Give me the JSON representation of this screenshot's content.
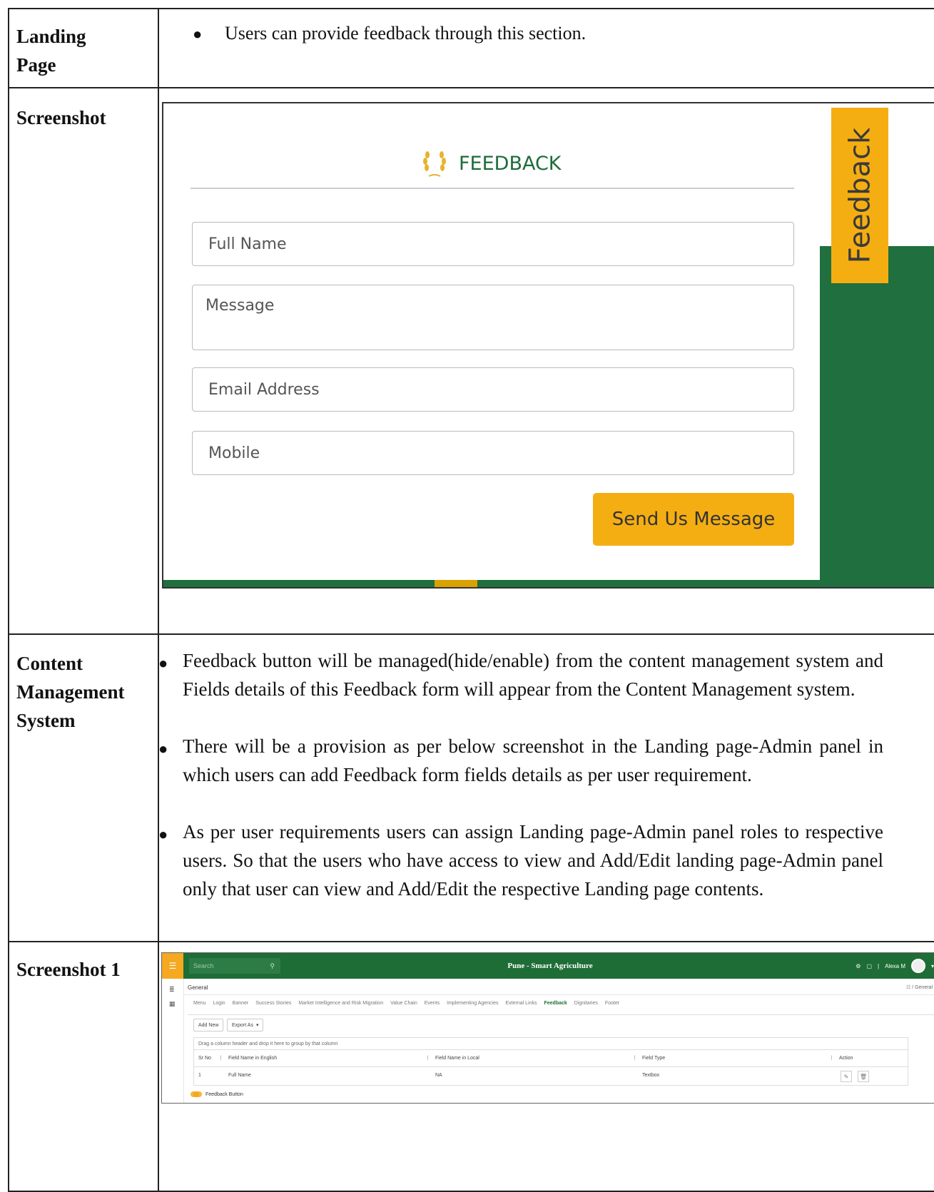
{
  "rows": {
    "landing": {
      "label_line1": "Landing",
      "label_line2": "Page",
      "bullet": "Users can provide feedback through this section."
    },
    "screenshot": {
      "label": "Screenshot"
    },
    "cms": {
      "label_line1": "Content",
      "label_line2": "Management",
      "label_line3": "System",
      "bullets": [
        "Feedback button will be managed(hide/enable) from the content management system and Fields details of this Feedback form will appear from the Content Management system.",
        "There will be a provision as per below screenshot in the Landing page-Admin panel in which users can add Feedback form fields details as per user requirement.",
        "As per user requirements users can assign Landing page-Admin panel roles to respective users. So that the users who have access to view and Add/Edit landing page-Admin panel only that user can view and Add/Edit the respective Landing page contents."
      ]
    },
    "screenshot1": {
      "label": "Screenshot 1"
    }
  },
  "feedback_form": {
    "title": "FEEDBACK",
    "side_tab": "Feedback",
    "fields": [
      "Full Name",
      "Message",
      "Email Address",
      "Mobile"
    ],
    "submit_label": "Send Us Message",
    "colors": {
      "green": "#1c6d3a",
      "amber": "#f5ae12"
    }
  },
  "admin_panel": {
    "search_placeholder": "Search",
    "app_title": "Pune - Smart Agriculture",
    "user_name": "Alexa M",
    "section_title": "General",
    "breadcrumb": "/ General",
    "tabs": [
      "Menu",
      "Login",
      "Banner",
      "Success Stories",
      "Market Intelligence and Risk Migration",
      "Value Chain",
      "Events",
      "Implementing Agencies",
      "External Links",
      "Feedback",
      "Dignitaries",
      "Footer"
    ],
    "active_tab": "Feedback",
    "add_new": "Add New",
    "export_as": "Export As",
    "drag_hint": "Drag a column header and drop it here to group by that column",
    "columns": [
      "Sr No",
      "Field Name in English",
      "Field Name in Local",
      "Field Type",
      "Action"
    ],
    "rows": [
      {
        "sr": "1",
        "english": "Full Name",
        "local": "NA",
        "type": "Textbox"
      }
    ],
    "toggle_label": "Feedback Button",
    "colors": {
      "topbar": "#1f6d36",
      "accent": "#f5a820"
    }
  }
}
